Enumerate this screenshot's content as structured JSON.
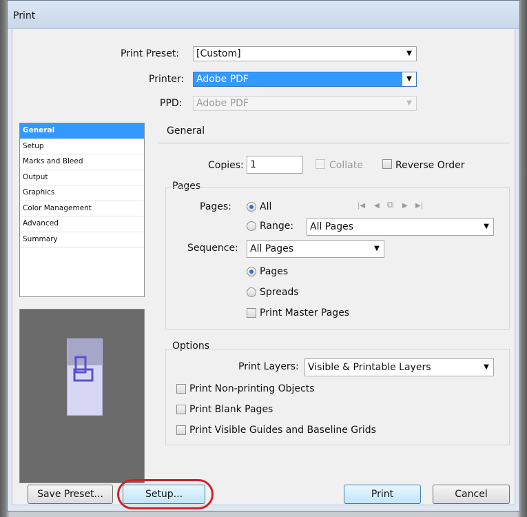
{
  "window": {
    "title": "Print"
  },
  "top": {
    "print_preset_label": "Print Preset:",
    "print_preset_value": "[Custom]",
    "printer_label": "Printer:",
    "printer_value": "Adobe PDF",
    "ppd_label": "PPD:",
    "ppd_value": "Adobe PDF"
  },
  "categories": [
    "General",
    "Setup",
    "Marks and Bleed",
    "Output",
    "Graphics",
    "Color Management",
    "Advanced",
    "Summary"
  ],
  "general": {
    "heading": "General",
    "copies_label": "Copies:",
    "copies_value": "1",
    "collate_label": "Collate",
    "reverse_order_label": "Reverse Order"
  },
  "pages": {
    "heading": "Pages",
    "pages_label": "Pages:",
    "all_label": "All",
    "range_label": "Range:",
    "range_value": "All Pages",
    "sequence_label": "Sequence:",
    "sequence_value": "All Pages",
    "pages_option": "Pages",
    "spreads_option": "Spreads",
    "print_master_pages": "Print Master Pages"
  },
  "options": {
    "heading": "Options",
    "print_layers_label": "Print Layers:",
    "print_layers_value": "Visible & Printable Layers",
    "non_printing_objects": "Print Non-printing Objects",
    "blank_pages": "Print Blank Pages",
    "visible_guides": "Print Visible Guides and Baseline Grids"
  },
  "buttons": {
    "save_preset": "Save Preset...",
    "setup": "Setup...",
    "print": "Print",
    "cancel": "Cancel"
  },
  "colors": {
    "selection": "#3399ff",
    "annotation": "#d0202a"
  }
}
